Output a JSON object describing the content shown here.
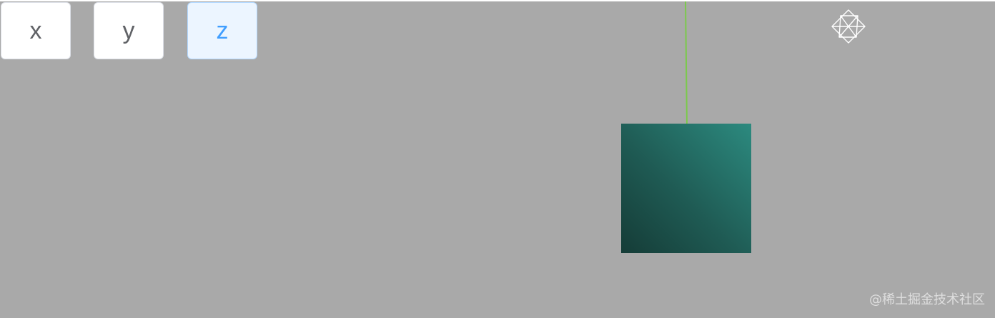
{
  "axis_buttons": {
    "x_label": "x",
    "y_label": "y",
    "z_label": "z",
    "selected": "z"
  },
  "scene": {
    "background": "#a9a9a9",
    "cube_colors": [
      "#2c8a7f",
      "#153c37"
    ],
    "y_axis_color": "#7cc94d",
    "x_axis_colors": [
      "#e04a3a",
      "#e8a04a"
    ],
    "helper_icon": "wireframe-octahedron-icon"
  },
  "watermark": {
    "text": "@稀土掘金技术社区"
  }
}
